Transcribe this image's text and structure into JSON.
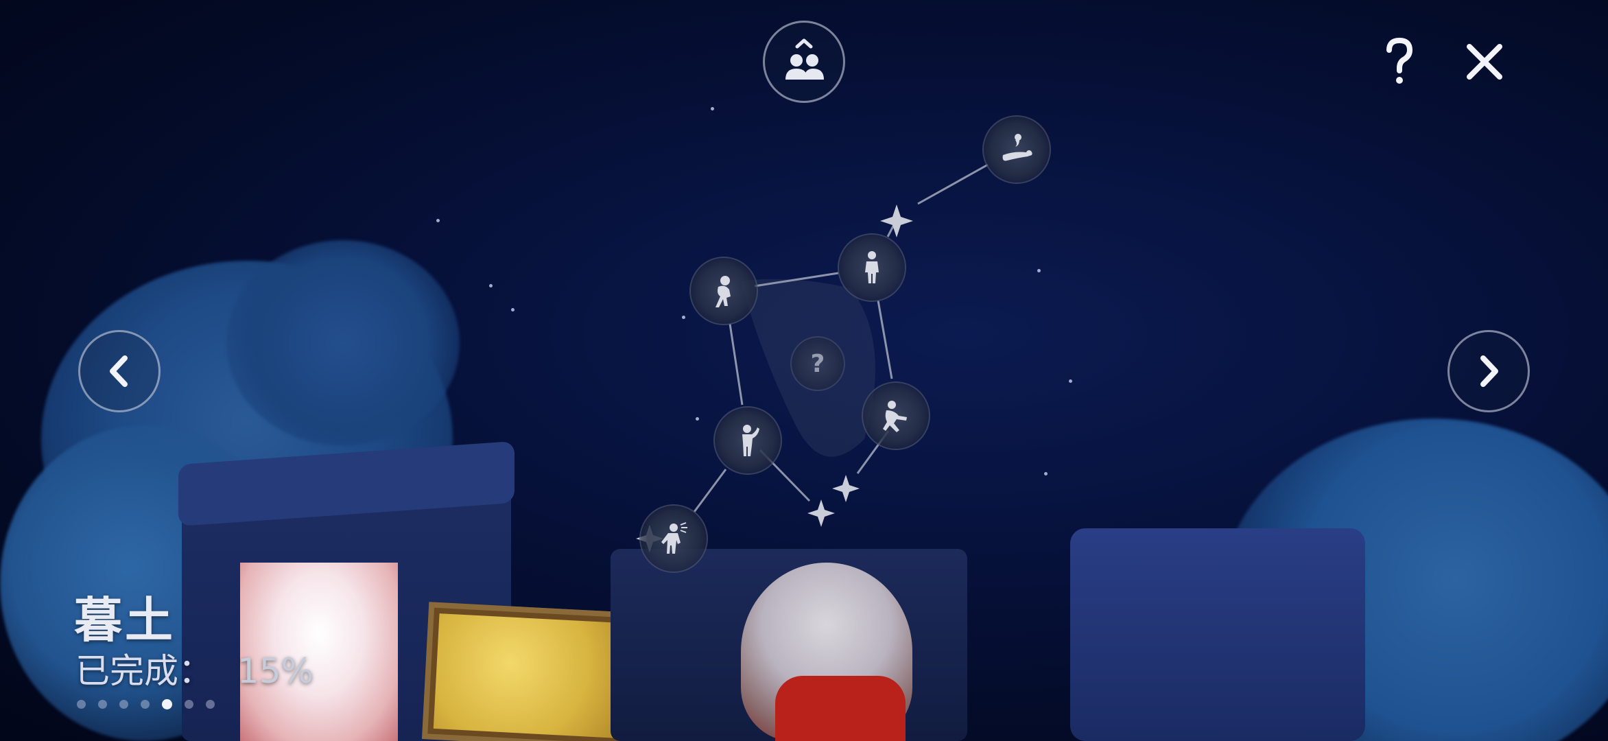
{
  "realm": {
    "name": "暮土",
    "progress_label": "已完成：",
    "progress_value": "15%",
    "progress_fraction": 0.15,
    "page_count": 7,
    "active_page": 5
  },
  "hud": {
    "friends_icon": "friends-icon",
    "help_icon": "question-mark-icon",
    "close_icon": "close-x-icon",
    "prev_icon": "chevron-left-icon",
    "next_icon": "chevron-right-icon"
  },
  "constellation": {
    "nodes": [
      {
        "id": "spirit-lying-down",
        "icon": "lying-spirit-icon",
        "unlocked": true
      },
      {
        "id": "spirit-standing",
        "icon": "standing-spirit-icon",
        "unlocked": true
      },
      {
        "id": "spirit-crouching",
        "icon": "crouching-spirit-icon",
        "unlocked": true
      },
      {
        "id": "spirit-unknown",
        "icon": "question-mark-icon",
        "label": "?",
        "unlocked": false
      },
      {
        "id": "spirit-running",
        "icon": "running-spirit-icon",
        "unlocked": true
      },
      {
        "id": "spirit-salute",
        "icon": "saluting-spirit-icon",
        "unlocked": true
      },
      {
        "id": "spirit-shouting",
        "icon": "shouting-spirit-icon",
        "unlocked": true
      }
    ],
    "stars": [
      "star-1",
      "star-2",
      "star-3",
      "star-4"
    ]
  },
  "colors": {
    "sky": "#06113a",
    "node_fill": "#343c55",
    "line": "#b9bfcd",
    "text": "#e8ebf4"
  }
}
